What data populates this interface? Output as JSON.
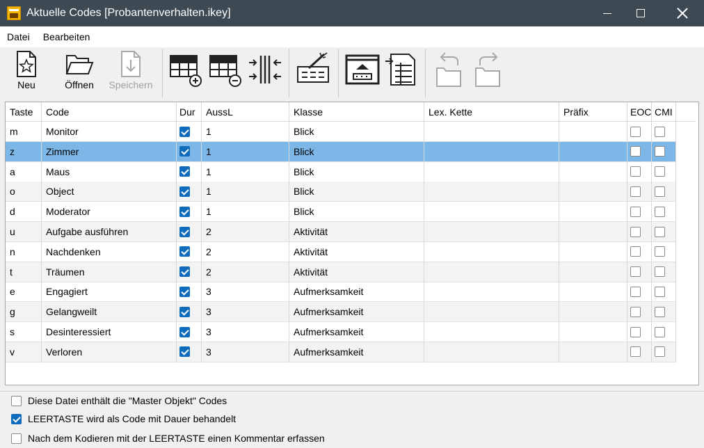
{
  "window": {
    "title": "Aktuelle Codes [Probantenverhalten.ikey]"
  },
  "menu": {
    "items": [
      "Datei",
      "Bearbeiten"
    ]
  },
  "toolbar": {
    "new_label": "Neu",
    "open_label": "Öffnen",
    "save_label": "Speichern"
  },
  "table": {
    "columns": [
      "Taste",
      "Code",
      "Dur",
      "AussL",
      "Klasse",
      "Lex. Kette",
      "Präfix",
      "EOC",
      "CMI"
    ],
    "rows": [
      {
        "key": "m",
        "code": "Monitor",
        "dur": true,
        "aussl": "1",
        "klasse": "Blick",
        "lex": "",
        "prefix": "",
        "eoc": false,
        "cmi": false
      },
      {
        "key": "z",
        "code": "Zimmer",
        "dur": true,
        "aussl": "1",
        "klasse": "Blick",
        "lex": "",
        "prefix": "",
        "eoc": false,
        "cmi": false,
        "selected": true
      },
      {
        "key": "a",
        "code": "Maus",
        "dur": true,
        "aussl": "1",
        "klasse": "Blick",
        "lex": "",
        "prefix": "",
        "eoc": false,
        "cmi": false
      },
      {
        "key": "o",
        "code": "Object",
        "dur": true,
        "aussl": "1",
        "klasse": "Blick",
        "lex": "",
        "prefix": "",
        "eoc": false,
        "cmi": false
      },
      {
        "key": "d",
        "code": "Moderator",
        "dur": true,
        "aussl": "1",
        "klasse": "Blick",
        "lex": "",
        "prefix": "",
        "eoc": false,
        "cmi": false
      },
      {
        "key": "u",
        "code": "Aufgabe ausführen",
        "dur": true,
        "aussl": "2",
        "klasse": "Aktivität",
        "lex": "",
        "prefix": "",
        "eoc": false,
        "cmi": false
      },
      {
        "key": "n",
        "code": "Nachdenken",
        "dur": true,
        "aussl": "2",
        "klasse": "Aktivität",
        "lex": "",
        "prefix": "",
        "eoc": false,
        "cmi": false
      },
      {
        "key": "t",
        "code": "Träumen",
        "dur": true,
        "aussl": "2",
        "klasse": "Aktivität",
        "lex": "",
        "prefix": "",
        "eoc": false,
        "cmi": false
      },
      {
        "key": "e",
        "code": "Engagiert",
        "dur": true,
        "aussl": "3",
        "klasse": "Aufmerksamkeit",
        "lex": "",
        "prefix": "",
        "eoc": false,
        "cmi": false
      },
      {
        "key": "g",
        "code": "Gelangweilt",
        "dur": true,
        "aussl": "3",
        "klasse": "Aufmerksamkeit",
        "lex": "",
        "prefix": "",
        "eoc": false,
        "cmi": false
      },
      {
        "key": "s",
        "code": "Desinteressiert",
        "dur": true,
        "aussl": "3",
        "klasse": "Aufmerksamkeit",
        "lex": "",
        "prefix": "",
        "eoc": false,
        "cmi": false
      },
      {
        "key": "v",
        "code": "Verloren",
        "dur": true,
        "aussl": "3",
        "klasse": "Aufmerksamkeit",
        "lex": "",
        "prefix": "",
        "eoc": false,
        "cmi": false
      }
    ]
  },
  "options": [
    {
      "label": "Diese Datei enthält die \"Master Objekt\" Codes",
      "checked": false
    },
    {
      "label": "LEERTASTE wird als Code mit Dauer behandelt",
      "checked": true
    },
    {
      "label": "Nach dem Kodieren mit der LEERTASTE einen Kommentar erfassen",
      "checked": false
    }
  ],
  "colors": {
    "titlebar": "#3e4a53",
    "selection": "#7db7e8",
    "checkbox_on": "#0f6cbd"
  }
}
